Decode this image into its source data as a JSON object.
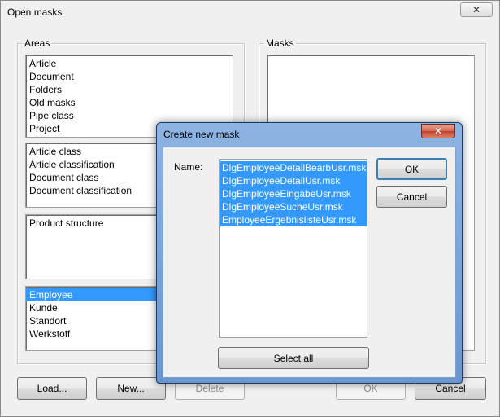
{
  "window": {
    "title": "Open masks",
    "close_glyph": "✕"
  },
  "areas": {
    "legend": "Areas",
    "lists": [
      [
        "Article",
        "Document",
        "Folders",
        "Old masks",
        "Pipe class",
        "Project"
      ],
      [
        "Article class",
        "Article classification",
        "Document class",
        "Document classification"
      ],
      [
        "Product structure"
      ],
      [
        "Employee",
        "Kunde",
        "Standort",
        "Werkstoff"
      ]
    ],
    "selected": "Employee"
  },
  "masks": {
    "legend": "Masks"
  },
  "buttons": {
    "load": "Load...",
    "new": "New...",
    "delete": "Delete",
    "ok": "OK",
    "cancel": "Cancel"
  },
  "dialog": {
    "title": "Create new mask",
    "close_glyph": "✕",
    "name_label": "Name:",
    "names": [
      "DlgEmployeeDetailBearbUsr.msk",
      "DlgEmployeeDetailUsr.msk",
      "DlgEmployeeEingabeUsr.msk",
      "DlgEmployeeSucheUsr.msk",
      "EmployeeErgebnislisteUsr.msk"
    ],
    "ok": "OK",
    "cancel": "Cancel",
    "select_all": "Select all"
  },
  "colors": {
    "selection": "#3399ff",
    "dialog_frame": "#7ea6d8",
    "close_red": "#c7432e"
  }
}
